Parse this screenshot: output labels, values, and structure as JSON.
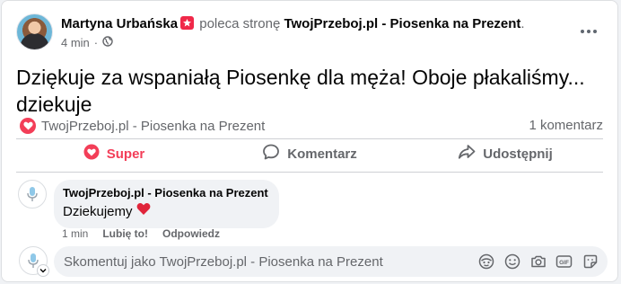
{
  "post": {
    "author": "Martyna Urbańska",
    "recommend_text": "poleca stronę",
    "page_name": "TwojPrzeboj.pl - Piosenka na Prezent",
    "period": ".",
    "time": "4 min",
    "dot": "·",
    "privacy_icon": "globe-icon",
    "text": "Dziękuje za wspaniałą Piosenkę dla męża! Oboje płakaliśmy... dziekuje"
  },
  "reactions": {
    "icon": "heart-reaction-icon",
    "names": "TwojPrzeboj.pl - Piosenka na Prezent",
    "comment_count": "1 komentarz"
  },
  "actions": {
    "super_label": "Super",
    "comment_label": "Komentarz",
    "share_label": "Udostępnij"
  },
  "comment": {
    "author": "TwojPrzeboj.pl - Piosenka na Prezent",
    "text": "Dziekujemy",
    "emoji": "❤️",
    "time": "1 min",
    "like_label": "Lubię to!",
    "reply_label": "Odpowiedz"
  },
  "composer": {
    "placeholder": "Skomentuj jako TwojPrzeboj.pl - Piosenka na Prezent",
    "icons": [
      "avatar-sticker-icon",
      "emoji-icon",
      "camera-icon",
      "gif-icon",
      "sticker-icon"
    ]
  },
  "colors": {
    "accent": "#f33e58",
    "text_secondary": "#65676b",
    "background": "#f0f2f5"
  }
}
